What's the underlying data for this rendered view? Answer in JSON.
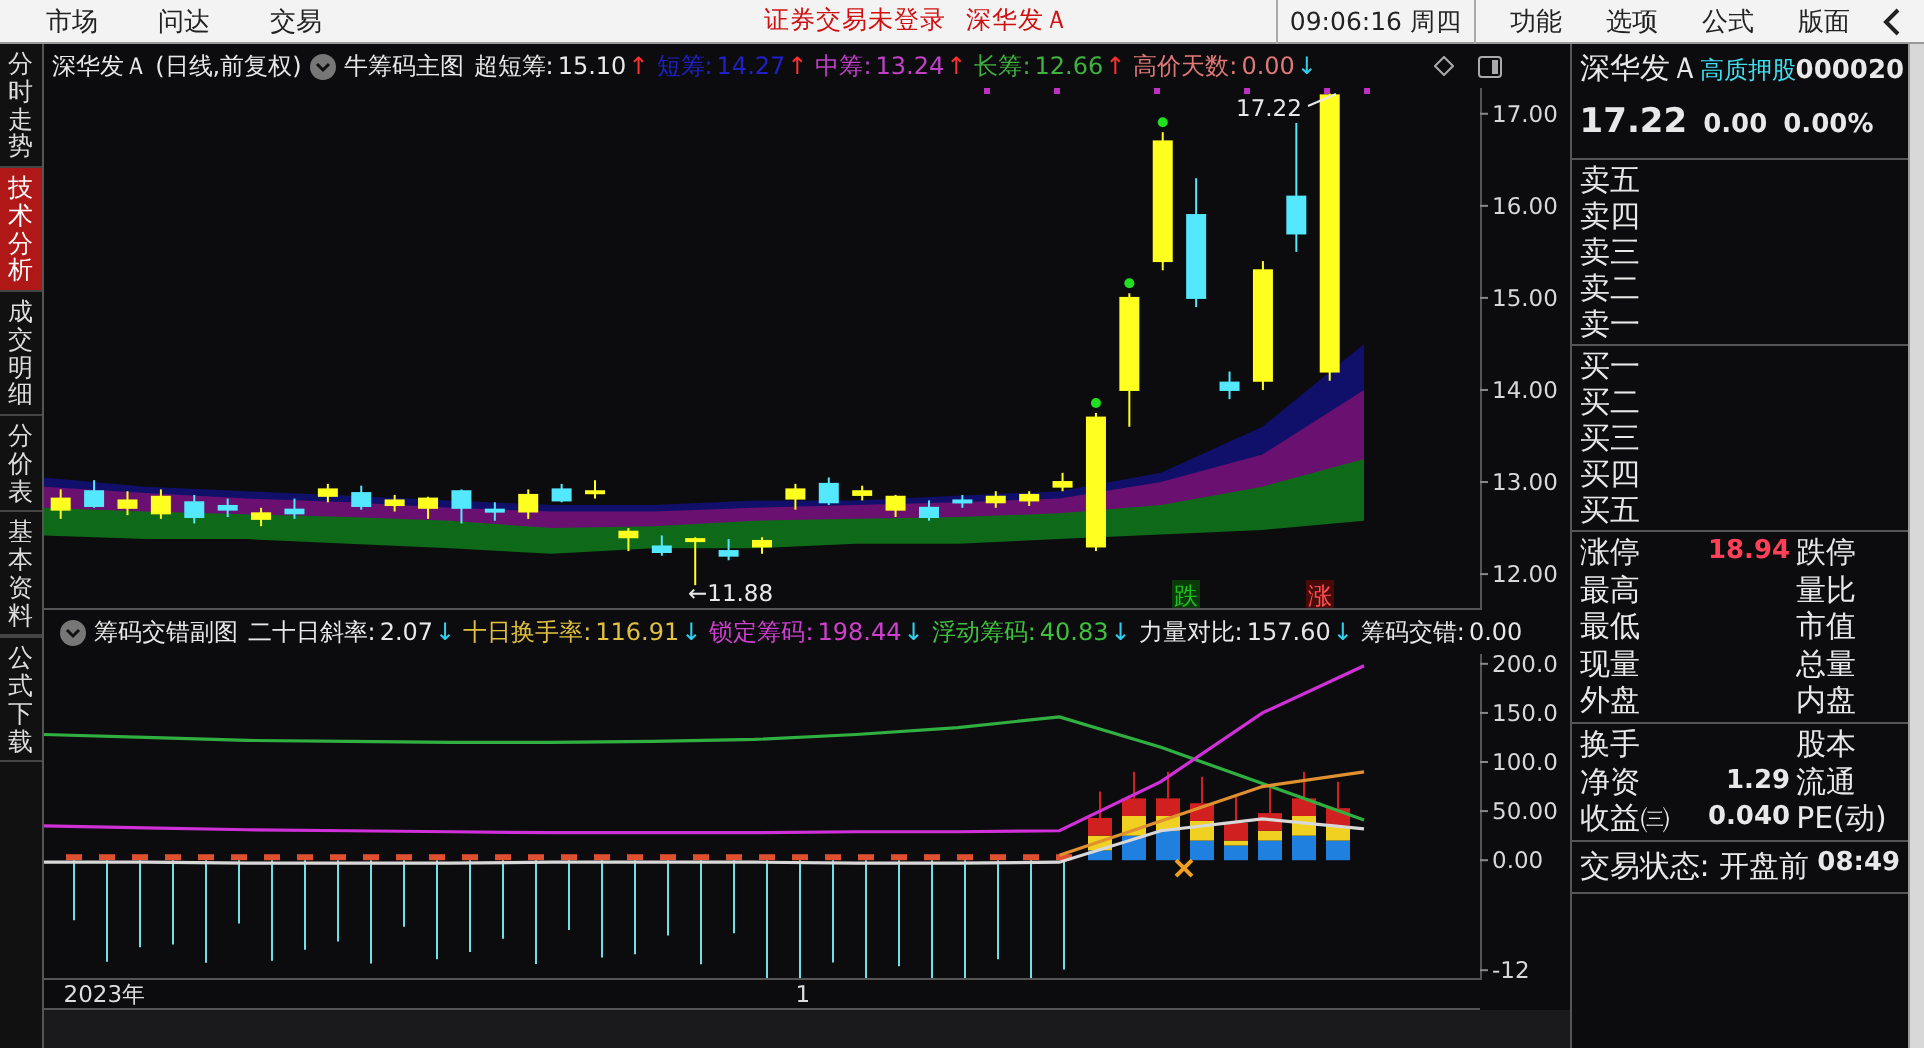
{
  "menu": [
    {
      "label": "市场"
    },
    {
      "label": "问达"
    },
    {
      "label": "交易"
    }
  ],
  "notice": {
    "message": "证券交易未登录",
    "stock": "深华发Ａ"
  },
  "clock": "09:06:16 周四",
  "right_menu": [
    {
      "label": "功能"
    },
    {
      "label": "选项"
    },
    {
      "label": "公式"
    },
    {
      "label": "版面"
    }
  ],
  "side_tabs": [
    {
      "label": "分时走势",
      "selected": false
    },
    {
      "label": "技术分析",
      "selected": true
    },
    {
      "label": "成交明细",
      "selected": false
    },
    {
      "label": "分价表",
      "selected": false
    },
    {
      "label": "基本资料",
      "selected": false
    }
  ],
  "formula_tab": {
    "label": "公式下载"
  },
  "main_chart": {
    "title": "深华发Ａ (日线,前复权)",
    "indicator": "牛筹码主图",
    "readings": [
      {
        "label": "超短筹:",
        "value": "15.10",
        "color": "#e8e8e8",
        "arrow": {
          "symbol": "↑",
          "color": "#ff3030"
        }
      },
      {
        "label": "短筹:",
        "value": "14.27",
        "color": "#2020c8",
        "arrow": {
          "symbol": "↑",
          "color": "#ff3030"
        }
      },
      {
        "label": "中筹:",
        "value": "13.24",
        "color": "#c040c8",
        "arrow": {
          "symbol": "↑",
          "color": "#ff3030"
        }
      },
      {
        "label": "长筹:",
        "value": "12.66",
        "color": "#40b040",
        "arrow": {
          "symbol": "↑",
          "color": "#ff3030"
        }
      },
      {
        "label": "高价天数:",
        "value": "0.00",
        "color": "#e07878",
        "arrow": {
          "symbol": "↓",
          "color": "#30d0f0"
        }
      }
    ],
    "high_label": "17.22",
    "low_label": "←11.88",
    "markers": [
      {
        "label": "跌",
        "kind": "fall"
      },
      {
        "label": "涨",
        "kind": "rise"
      }
    ],
    "chart_data": {
      "type": "candlestick",
      "ylim": [
        11.61,
        17.28
      ],
      "yticks": [
        {
          "value": 17,
          "label": "17.00"
        },
        {
          "value": 16,
          "label": "16.00"
        },
        {
          "value": 15,
          "label": "15.00"
        },
        {
          "value": 14,
          "label": "14.00"
        },
        {
          "value": 13,
          "label": "13.00"
        },
        {
          "value": 12,
          "label": "12.00"
        }
      ],
      "categories": [
        null,
        null,
        null,
        null,
        null,
        null,
        null,
        null,
        null,
        null,
        null,
        null,
        null,
        null,
        null,
        null,
        null,
        null,
        null,
        null,
        null,
        null,
        null,
        null,
        null,
        null,
        null,
        null,
        null,
        null,
        null,
        null,
        null,
        null,
        null,
        null,
        null,
        null,
        null,
        null,
        null,
        null,
        null
      ],
      "ohlc": [
        [
          12.7,
          12.92,
          12.6,
          12.82
        ],
        [
          12.9,
          13.02,
          12.72,
          12.74
        ],
        [
          12.72,
          12.9,
          12.64,
          12.8
        ],
        [
          12.66,
          12.92,
          12.6,
          12.84
        ],
        [
          12.78,
          12.86,
          12.55,
          12.62
        ],
        [
          12.74,
          12.82,
          12.62,
          12.7
        ],
        [
          12.6,
          12.72,
          12.52,
          12.66
        ],
        [
          12.7,
          12.82,
          12.6,
          12.66
        ],
        [
          12.85,
          12.98,
          12.78,
          12.92
        ],
        [
          12.88,
          12.96,
          12.7,
          12.74
        ],
        [
          12.75,
          12.86,
          12.68,
          12.8
        ],
        [
          12.72,
          12.84,
          12.6,
          12.82
        ],
        [
          12.9,
          12.92,
          12.55,
          12.72
        ],
        [
          12.7,
          12.78,
          12.58,
          12.68
        ],
        [
          12.68,
          12.92,
          12.6,
          12.86
        ],
        [
          12.92,
          12.98,
          12.78,
          12.8
        ],
        [
          12.88,
          13.02,
          12.82,
          12.9
        ],
        [
          12.4,
          12.5,
          12.25,
          12.46
        ],
        [
          12.3,
          12.42,
          12.2,
          12.24
        ],
        [
          12.36,
          12.4,
          11.88,
          12.38
        ],
        [
          12.25,
          12.38,
          12.15,
          12.2
        ],
        [
          12.3,
          12.4,
          12.22,
          12.36
        ],
        [
          12.82,
          12.98,
          12.7,
          12.92
        ],
        [
          12.98,
          13.05,
          12.75,
          12.78
        ],
        [
          12.86,
          12.96,
          12.8,
          12.9
        ],
        [
          12.7,
          12.86,
          12.62,
          12.84
        ],
        [
          12.72,
          12.8,
          12.58,
          12.62
        ],
        [
          12.8,
          12.86,
          12.72,
          12.78
        ],
        [
          12.78,
          12.9,
          12.72,
          12.84
        ],
        [
          12.8,
          12.9,
          12.74,
          12.86
        ],
        [
          12.95,
          13.1,
          12.9,
          13.0
        ],
        [
          12.3,
          13.75,
          12.25,
          13.7
        ],
        [
          14.0,
          15.05,
          13.6,
          15.0
        ],
        [
          15.4,
          16.8,
          15.3,
          16.7
        ],
        [
          15.9,
          16.3,
          14.9,
          15.0
        ],
        [
          14.08,
          14.2,
          13.9,
          14.0
        ],
        [
          14.1,
          15.4,
          14.0,
          15.3
        ],
        [
          16.1,
          16.9,
          15.5,
          15.7
        ],
        [
          14.2,
          17.22,
          14.1,
          17.2
        ],
        null,
        null,
        null,
        null
      ]
    }
  },
  "sub_chart": {
    "indicator": "筹码交错副图",
    "readings": [
      {
        "label": "二十日斜率:",
        "value": "2.07",
        "color": "#e8e8e8",
        "arrow": {
          "symbol": "↓",
          "color": "#30d0f0"
        }
      },
      {
        "label": "十日换手率:",
        "value": "116.91",
        "color": "#e0c040",
        "arrow": {
          "symbol": "↓",
          "color": "#30d0f0"
        }
      },
      {
        "label": "锁定筹码:",
        "value": "198.44",
        "color": "#d040d0",
        "arrow": {
          "symbol": "↓",
          "color": "#30d0f0"
        }
      },
      {
        "label": "浮动筹码:",
        "value": "40.83",
        "color": "#40c040",
        "arrow": {
          "symbol": "↓",
          "color": "#30d0f0"
        }
      },
      {
        "label": "力量对比:",
        "value": "157.60",
        "color": "#e8e8e8",
        "arrow": {
          "symbol": "↓",
          "color": "#30d0f0"
        }
      },
      {
        "label": "筹码交错:",
        "value": "0.00",
        "color": "#e8e8e8"
      }
    ],
    "chart_data": {
      "type": "line",
      "ylim": [
        -122,
        210
      ],
      "yticks": [
        {
          "value": 200,
          "label": "200.0"
        },
        {
          "value": 150,
          "label": "150.0"
        },
        {
          "value": 100,
          "label": "100.0"
        },
        {
          "value": 50,
          "label": "50.00"
        },
        {
          "value": 0,
          "label": "0.00"
        }
      ],
      "series": [
        {
          "color": "#30b040",
          "values": [
            128,
            125,
            122,
            121,
            120,
            120,
            121,
            123,
            128,
            135,
            146,
            115,
            78,
            41
          ]
        },
        {
          "color": "#d030d8",
          "values": [
            35,
            33,
            31,
            30,
            29,
            28,
            28,
            28,
            29,
            29,
            30,
            80,
            150,
            198
          ]
        },
        {
          "color": "#e09030",
          "values": [
            null,
            null,
            null,
            null,
            null,
            null,
            null,
            null,
            null,
            null,
            5,
            40,
            75,
            90
          ]
        },
        {
          "color": "#d8d8d8",
          "values": [
            -2,
            -2,
            -3,
            -3,
            -3,
            -2,
            -2,
            -2,
            -3,
            -3,
            -2,
            30,
            42,
            32
          ]
        }
      ]
    },
    "cut_tick_label": "-12"
  },
  "date_axis": [
    "2023年",
    "1"
  ],
  "quote": {
    "name": "深华发Ａ",
    "tag": "高质押股",
    "code": "000020",
    "price": "17.22",
    "change": "0.00",
    "percent": "0.00%",
    "sells": [
      "卖五",
      "卖四",
      "卖三",
      "卖二",
      "卖一"
    ],
    "buys": [
      "买一",
      "买二",
      "买三",
      "买四",
      "买五"
    ],
    "stats": [
      {
        "label": "涨停",
        "value": "18.94",
        "label2": "跌停"
      },
      {
        "label": "最高",
        "label2": "量比"
      },
      {
        "label": "最低",
        "label2": "市值"
      },
      {
        "label": "现量",
        "label2": "总量"
      },
      {
        "label": "外盘",
        "label2": "内盘"
      }
    ],
    "stats2": [
      {
        "label": "换手",
        "label2": "股本"
      },
      {
        "label": "净资",
        "value": "1.29",
        "label2": "流通"
      },
      {
        "label": "收益㈢",
        "value": "0.040",
        "label2": "PE(动)"
      }
    ],
    "status_label": "交易状态: 开盘前",
    "status_time": "08:49"
  }
}
